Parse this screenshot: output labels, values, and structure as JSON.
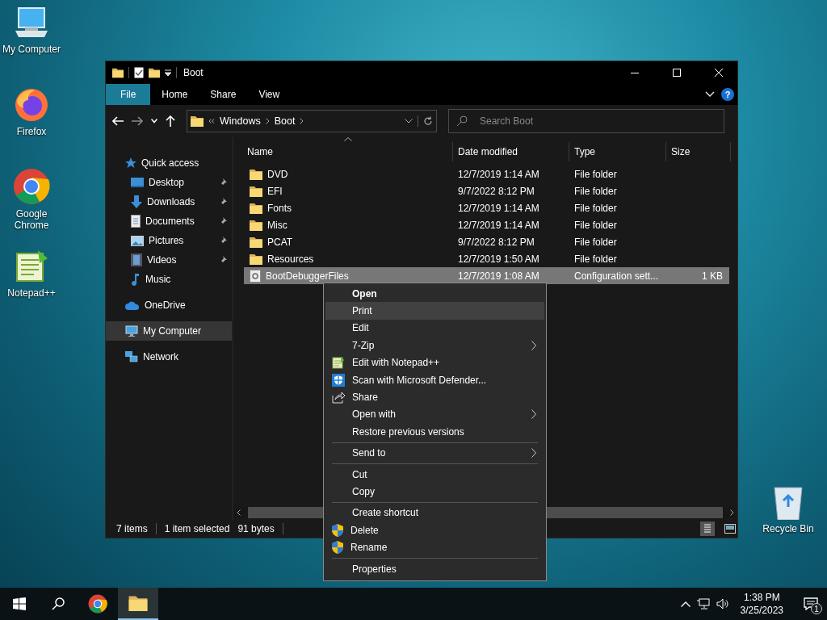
{
  "desktop_icons": [
    {
      "label": "My Computer",
      "kind": "computer"
    },
    {
      "label": "Firefox",
      "kind": "firefox"
    },
    {
      "label": "Google Chrome",
      "kind": "chrome"
    },
    {
      "label": "Notepad++",
      "kind": "notepad"
    }
  ],
  "recycle_bin": {
    "label": "Recycle Bin"
  },
  "window": {
    "title": "Boot",
    "ribbon_tabs": [
      {
        "label": "File",
        "selected": true
      },
      {
        "label": "Home",
        "selected": false
      },
      {
        "label": "Share",
        "selected": false
      },
      {
        "label": "View",
        "selected": false
      }
    ],
    "help_button": "?",
    "breadcrumbs": [
      "Windows",
      "Boot"
    ],
    "search": {
      "placeholder": "Search Boot"
    },
    "nav": [
      {
        "label": "Quick access",
        "kind": "star",
        "selected": false,
        "children": [
          {
            "label": "Desktop",
            "kind": "desktop",
            "pinned": true,
            "selected": false
          },
          {
            "label": "Downloads",
            "kind": "downloads",
            "pinned": true,
            "selected": false
          },
          {
            "label": "Documents",
            "kind": "documents",
            "pinned": true,
            "selected": false
          },
          {
            "label": "Pictures",
            "kind": "pictures",
            "pinned": true,
            "selected": false
          },
          {
            "label": "Videos",
            "kind": "videos",
            "pinned": true,
            "selected": false
          },
          {
            "label": "Music",
            "kind": "music",
            "pinned": false,
            "selected": false
          }
        ]
      },
      {
        "label": "OneDrive",
        "kind": "cloud",
        "selected": false
      },
      {
        "label": "My Computer",
        "kind": "computer",
        "selected": true
      },
      {
        "label": "Network",
        "kind": "network",
        "selected": false
      }
    ],
    "columns": [
      "Name",
      "Date modified",
      "Type",
      "Size"
    ],
    "rows": [
      {
        "name": "DVD",
        "date": "12/7/2019 1:14 AM",
        "type": "File folder",
        "kind": "folder",
        "selected": false
      },
      {
        "name": "EFI",
        "date": "9/7/2022 8:12 PM",
        "type": "File folder",
        "kind": "folder",
        "selected": false
      },
      {
        "name": "Fonts",
        "date": "12/7/2019 1:14 AM",
        "type": "File folder",
        "kind": "folder",
        "selected": false
      },
      {
        "name": "Misc",
        "date": "12/7/2019 1:14 AM",
        "type": "File folder",
        "kind": "folder",
        "selected": false
      },
      {
        "name": "PCAT",
        "date": "9/7/2022 8:12 PM",
        "type": "File folder",
        "kind": "folder",
        "selected": false
      },
      {
        "name": "Resources",
        "date": "12/7/2019 1:50 AM",
        "type": "File folder",
        "kind": "folder",
        "selected": false
      },
      {
        "name": "BootDebuggerFiles",
        "date": "12/7/2019 1:08 AM",
        "type": "Configuration sett...",
        "size": "1 KB",
        "kind": "config",
        "selected": true
      }
    ],
    "status_bar": {
      "count": "7 items",
      "selection": "1 item selected",
      "size": "91 bytes"
    }
  },
  "context_menu": [
    {
      "label": "Open",
      "kind": "plain",
      "default": true,
      "selected": false,
      "submenu": false
    },
    {
      "label": "Print",
      "kind": "plain",
      "default": false,
      "selected": true,
      "submenu": false
    },
    {
      "label": "Edit",
      "kind": "plain",
      "default": false,
      "selected": false,
      "submenu": false
    },
    {
      "label": "7-Zip",
      "kind": "plain",
      "default": false,
      "selected": false,
      "submenu": true
    },
    {
      "label": "Edit with Notepad++",
      "kind": "notepad",
      "default": false,
      "selected": false,
      "submenu": false
    },
    {
      "label": "Scan with Microsoft Defender...",
      "kind": "defender",
      "default": false,
      "selected": false,
      "submenu": false
    },
    {
      "label": "Share",
      "kind": "share",
      "default": false,
      "selected": false,
      "submenu": false
    },
    {
      "label": "Open with",
      "kind": "plain",
      "default": false,
      "selected": false,
      "submenu": true
    },
    {
      "label": "Restore previous versions",
      "kind": "plain",
      "default": false,
      "selected": false,
      "submenu": false
    },
    {
      "kind": "separator"
    },
    {
      "label": "Send to",
      "kind": "plain",
      "default": false,
      "selected": false,
      "submenu": true
    },
    {
      "kind": "separator"
    },
    {
      "label": "Cut",
      "kind": "plain",
      "default": false,
      "selected": false,
      "submenu": false
    },
    {
      "label": "Copy",
      "kind": "plain",
      "default": false,
      "selected": false,
      "submenu": false
    },
    {
      "kind": "separator"
    },
    {
      "label": "Create shortcut",
      "kind": "plain",
      "default": false,
      "selected": false,
      "submenu": false
    },
    {
      "label": "Delete",
      "kind": "shield",
      "default": false,
      "selected": false,
      "submenu": false
    },
    {
      "label": "Rename",
      "kind": "shield",
      "default": false,
      "selected": false,
      "submenu": false
    },
    {
      "kind": "separator"
    },
    {
      "label": "Properties",
      "kind": "plain",
      "default": false,
      "selected": false,
      "submenu": false
    }
  ],
  "taskbar": {
    "apps": [
      {
        "kind": "chrome",
        "selected": false
      },
      {
        "kind": "explorer",
        "selected": true
      }
    ],
    "time": "1:38 PM",
    "date": "3/25/2023",
    "notifications": "1"
  }
}
